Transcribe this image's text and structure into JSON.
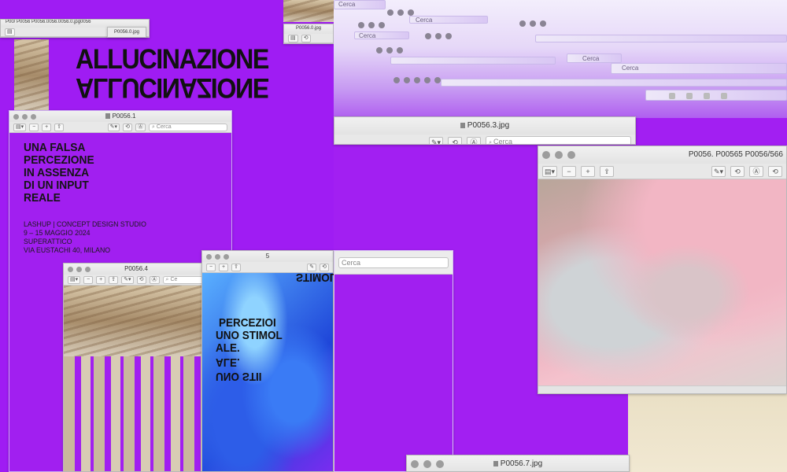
{
  "poster": {
    "headline": "ALLUCINAZIONE",
    "headline_mirror": "ALLUCINAZIONE",
    "lead": [
      "UNA FALSA",
      "PERCEZIONE",
      "IN ASSENZA",
      "DI UN INPUT",
      "REALE"
    ],
    "info": [
      "LASHUP | CONCEPT DESIGN STUDIO",
      "9 – 15 MAGGIO 2024",
      "SUPERATTICO",
      "VIA EUSTACHI 40, MILANO"
    ],
    "overlay_lines": [
      "STIMOL",
      "PERCEZIOI",
      "UNO STIMOL",
      "ALE.",
      "ALE.",
      "UNO STII"
    ]
  },
  "windows": {
    "w1": {
      "title": "P0056.1",
      "search": "Cerca"
    },
    "w4": {
      "title": "P0056.4",
      "search": "Ce"
    },
    "w5": {
      "title": "5"
    },
    "w_mid": {
      "title": "P0056.3.jpg",
      "search": "Cerca"
    },
    "w_cerca": {
      "search": "Cerca"
    },
    "w_right": {
      "title": "P0056. P00565 P0056/566",
      "search": ""
    },
    "w_bottom": {
      "title": "P0056.7.jpg"
    },
    "top_left_strip": {
      "text": "P00/  P0056  P0056.0056.0056.0.jpg0056",
      "title2": "P0056.0.jpg",
      "title3": "P0056.0.jpg"
    }
  },
  "glitch_bars": {
    "labels": [
      "Cerca",
      "Cerca",
      "Cerca",
      "Cerca",
      "Cerca",
      "Cerca"
    ]
  },
  "icons": [
    "sidebar-icon",
    "zoom-out-icon",
    "zoom-in-icon",
    "share-icon",
    "markup-icon",
    "rotate-icon",
    "search-icon"
  ]
}
